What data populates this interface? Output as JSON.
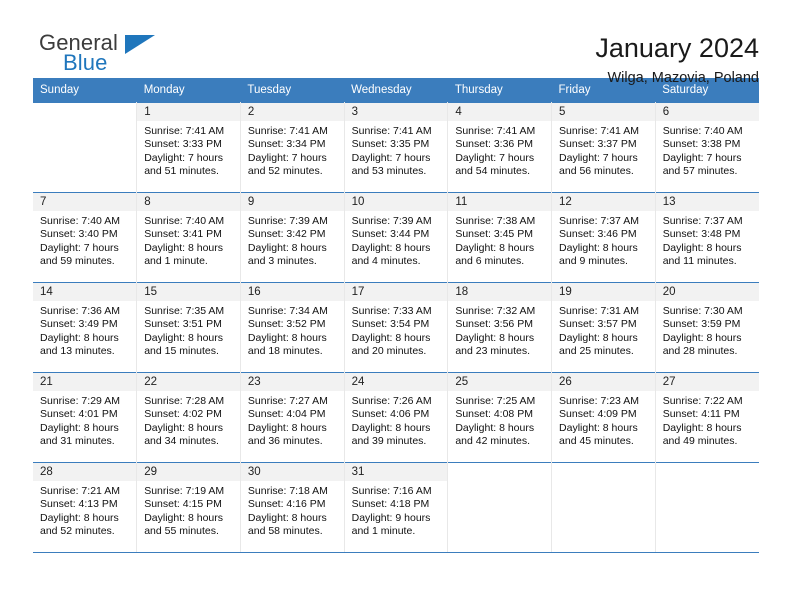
{
  "brand": {
    "word_one": "General",
    "word_two": "Blue",
    "logo_icon": "triangle-logo-icon"
  },
  "header": {
    "title": "January 2024",
    "subtitle": "Wilga, Mazovia, Poland"
  },
  "colors": {
    "header_blue": "#3b7dbd",
    "brand_blue": "#1f76bc",
    "daynum_band": "#f2f2f2",
    "cell_divider": "#e8e8e8"
  },
  "calendar": {
    "weekday_headers": [
      "Sunday",
      "Monday",
      "Tuesday",
      "Wednesday",
      "Thursday",
      "Friday",
      "Saturday"
    ],
    "weeks": [
      [
        {
          "day": "",
          "lines": []
        },
        {
          "day": "1",
          "lines": [
            "Sunrise: 7:41 AM",
            "Sunset: 3:33 PM",
            "Daylight: 7 hours",
            "and 51 minutes."
          ]
        },
        {
          "day": "2",
          "lines": [
            "Sunrise: 7:41 AM",
            "Sunset: 3:34 PM",
            "Daylight: 7 hours",
            "and 52 minutes."
          ]
        },
        {
          "day": "3",
          "lines": [
            "Sunrise: 7:41 AM",
            "Sunset: 3:35 PM",
            "Daylight: 7 hours",
            "and 53 minutes."
          ]
        },
        {
          "day": "4",
          "lines": [
            "Sunrise: 7:41 AM",
            "Sunset: 3:36 PM",
            "Daylight: 7 hours",
            "and 54 minutes."
          ]
        },
        {
          "day": "5",
          "lines": [
            "Sunrise: 7:41 AM",
            "Sunset: 3:37 PM",
            "Daylight: 7 hours",
            "and 56 minutes."
          ]
        },
        {
          "day": "6",
          "lines": [
            "Sunrise: 7:40 AM",
            "Sunset: 3:38 PM",
            "Daylight: 7 hours",
            "and 57 minutes."
          ]
        }
      ],
      [
        {
          "day": "7",
          "lines": [
            "Sunrise: 7:40 AM",
            "Sunset: 3:40 PM",
            "Daylight: 7 hours",
            "and 59 minutes."
          ]
        },
        {
          "day": "8",
          "lines": [
            "Sunrise: 7:40 AM",
            "Sunset: 3:41 PM",
            "Daylight: 8 hours",
            "and 1 minute."
          ]
        },
        {
          "day": "9",
          "lines": [
            "Sunrise: 7:39 AM",
            "Sunset: 3:42 PM",
            "Daylight: 8 hours",
            "and 3 minutes."
          ]
        },
        {
          "day": "10",
          "lines": [
            "Sunrise: 7:39 AM",
            "Sunset: 3:44 PM",
            "Daylight: 8 hours",
            "and 4 minutes."
          ]
        },
        {
          "day": "11",
          "lines": [
            "Sunrise: 7:38 AM",
            "Sunset: 3:45 PM",
            "Daylight: 8 hours",
            "and 6 minutes."
          ]
        },
        {
          "day": "12",
          "lines": [
            "Sunrise: 7:37 AM",
            "Sunset: 3:46 PM",
            "Daylight: 8 hours",
            "and 9 minutes."
          ]
        },
        {
          "day": "13",
          "lines": [
            "Sunrise: 7:37 AM",
            "Sunset: 3:48 PM",
            "Daylight: 8 hours",
            "and 11 minutes."
          ]
        }
      ],
      [
        {
          "day": "14",
          "lines": [
            "Sunrise: 7:36 AM",
            "Sunset: 3:49 PM",
            "Daylight: 8 hours",
            "and 13 minutes."
          ]
        },
        {
          "day": "15",
          "lines": [
            "Sunrise: 7:35 AM",
            "Sunset: 3:51 PM",
            "Daylight: 8 hours",
            "and 15 minutes."
          ]
        },
        {
          "day": "16",
          "lines": [
            "Sunrise: 7:34 AM",
            "Sunset: 3:52 PM",
            "Daylight: 8 hours",
            "and 18 minutes."
          ]
        },
        {
          "day": "17",
          "lines": [
            "Sunrise: 7:33 AM",
            "Sunset: 3:54 PM",
            "Daylight: 8 hours",
            "and 20 minutes."
          ]
        },
        {
          "day": "18",
          "lines": [
            "Sunrise: 7:32 AM",
            "Sunset: 3:56 PM",
            "Daylight: 8 hours",
            "and 23 minutes."
          ]
        },
        {
          "day": "19",
          "lines": [
            "Sunrise: 7:31 AM",
            "Sunset: 3:57 PM",
            "Daylight: 8 hours",
            "and 25 minutes."
          ]
        },
        {
          "day": "20",
          "lines": [
            "Sunrise: 7:30 AM",
            "Sunset: 3:59 PM",
            "Daylight: 8 hours",
            "and 28 minutes."
          ]
        }
      ],
      [
        {
          "day": "21",
          "lines": [
            "Sunrise: 7:29 AM",
            "Sunset: 4:01 PM",
            "Daylight: 8 hours",
            "and 31 minutes."
          ]
        },
        {
          "day": "22",
          "lines": [
            "Sunrise: 7:28 AM",
            "Sunset: 4:02 PM",
            "Daylight: 8 hours",
            "and 34 minutes."
          ]
        },
        {
          "day": "23",
          "lines": [
            "Sunrise: 7:27 AM",
            "Sunset: 4:04 PM",
            "Daylight: 8 hours",
            "and 36 minutes."
          ]
        },
        {
          "day": "24",
          "lines": [
            "Sunrise: 7:26 AM",
            "Sunset: 4:06 PM",
            "Daylight: 8 hours",
            "and 39 minutes."
          ]
        },
        {
          "day": "25",
          "lines": [
            "Sunrise: 7:25 AM",
            "Sunset: 4:08 PM",
            "Daylight: 8 hours",
            "and 42 minutes."
          ]
        },
        {
          "day": "26",
          "lines": [
            "Sunrise: 7:23 AM",
            "Sunset: 4:09 PM",
            "Daylight: 8 hours",
            "and 45 minutes."
          ]
        },
        {
          "day": "27",
          "lines": [
            "Sunrise: 7:22 AM",
            "Sunset: 4:11 PM",
            "Daylight: 8 hours",
            "and 49 minutes."
          ]
        }
      ],
      [
        {
          "day": "28",
          "lines": [
            "Sunrise: 7:21 AM",
            "Sunset: 4:13 PM",
            "Daylight: 8 hours",
            "and 52 minutes."
          ]
        },
        {
          "day": "29",
          "lines": [
            "Sunrise: 7:19 AM",
            "Sunset: 4:15 PM",
            "Daylight: 8 hours",
            "and 55 minutes."
          ]
        },
        {
          "day": "30",
          "lines": [
            "Sunrise: 7:18 AM",
            "Sunset: 4:16 PM",
            "Daylight: 8 hours",
            "and 58 minutes."
          ]
        },
        {
          "day": "31",
          "lines": [
            "Sunrise: 7:16 AM",
            "Sunset: 4:18 PM",
            "Daylight: 9 hours",
            "and 1 minute."
          ]
        },
        {
          "day": "",
          "lines": []
        },
        {
          "day": "",
          "lines": []
        },
        {
          "day": "",
          "lines": []
        }
      ]
    ]
  }
}
